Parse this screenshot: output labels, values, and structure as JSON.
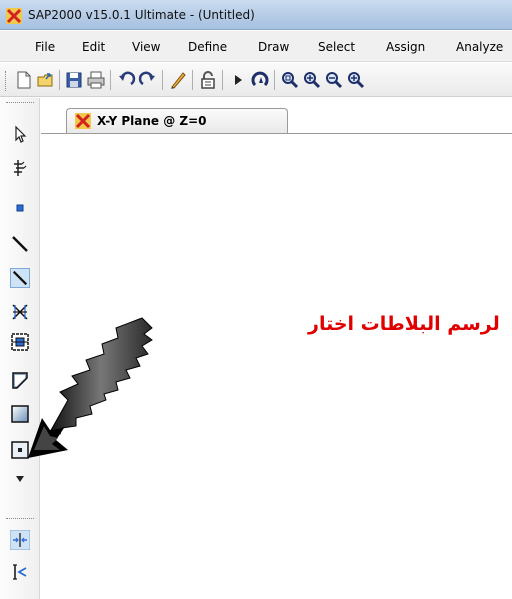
{
  "window": {
    "title": "SAP2000 v15.0.1 Ultimate  - (Untitled)",
    "app_icon": "sap2000-logo-icon"
  },
  "menu": {
    "items": [
      "File",
      "Edit",
      "View",
      "Define",
      "Draw",
      "Select",
      "Assign",
      "Analyze"
    ]
  },
  "toolbar": {
    "buttons": [
      "new-file-icon",
      "open-folder-icon",
      "save-icon",
      "print-icon",
      "undo-icon",
      "redo-icon",
      "pencil-icon",
      "lock-icon",
      "run-analysis-icon",
      "rotate-view-icon",
      "zoom-window-icon",
      "zoom-in-icon",
      "zoom-out-icon",
      "zoom-extents-icon"
    ]
  },
  "left_toolbar": {
    "buttons": [
      "pointer-icon",
      "reshape-icon",
      "draw-joint-icon",
      "draw-frame-icon",
      "quick-draw-frame-icon",
      "draw-brace-icon",
      "draw-section-cut-icon",
      "draw-poly-area-icon",
      "draw-rect-area-icon",
      "quick-draw-area-icon",
      "dropdown-arrow-icon",
      "snap-to-points-icon",
      "snap-to-ends-icon"
    ],
    "pressed": "quick-draw-frame-icon"
  },
  "tab": {
    "label": "X-Y Plane @ Z=0"
  },
  "annotation": {
    "text": "لرسم البلاطات اختار"
  },
  "colors": {
    "annotation": "#e00000",
    "title_bar": "#b7cde6",
    "background": "#ffffff"
  }
}
